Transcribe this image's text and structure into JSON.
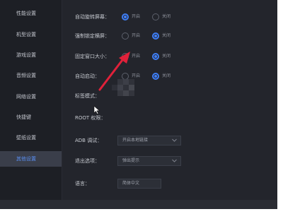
{
  "sidebar": {
    "items": [
      {
        "label": "性能设置",
        "active": false
      },
      {
        "label": "机型设置",
        "active": false
      },
      {
        "label": "游戏设置",
        "active": false
      },
      {
        "label": "音频设置",
        "active": false
      },
      {
        "label": "网络设置",
        "active": false
      },
      {
        "label": "快捷键",
        "active": false
      },
      {
        "label": "壁纸设置",
        "active": false
      },
      {
        "label": "其他设置",
        "active": true
      }
    ]
  },
  "settings": {
    "auto_rotate": {
      "label": "自动旋转屏幕：",
      "on": "开启",
      "off": "关闭",
      "selected": "on"
    },
    "force_landscape": {
      "label": "强制锁定横屏：",
      "on": "开启",
      "off": "关闭",
      "selected": "off"
    },
    "fixed_window_size": {
      "label": "固定窗口大小：",
      "on": "开启",
      "off": "关闭",
      "selected": "off"
    },
    "auto_start": {
      "label": "自动启动：",
      "on": "开启",
      "off": "关闭",
      "selected": "off"
    },
    "tab_mode": {
      "label": "标签模式："
    },
    "root_permission": {
      "label": "ROOT 权限："
    },
    "adb_debug": {
      "label": "ADB 调试：",
      "value": "开启本地链接"
    },
    "exit_option": {
      "label": "退出选项：",
      "value": "弹出提示"
    },
    "language": {
      "label": "语言：",
      "value": "简体中文"
    }
  },
  "colors": {
    "window_bg": "#23252c",
    "sidebar_bg": "#1d1f25",
    "accent": "#3f7ef5",
    "annotation_arrow": "#e0213a"
  },
  "icons": {
    "dropdown": "chevron-down-icon",
    "cursor": "mouse-pointer-icon",
    "annotation": "red-arrow-annotation"
  }
}
